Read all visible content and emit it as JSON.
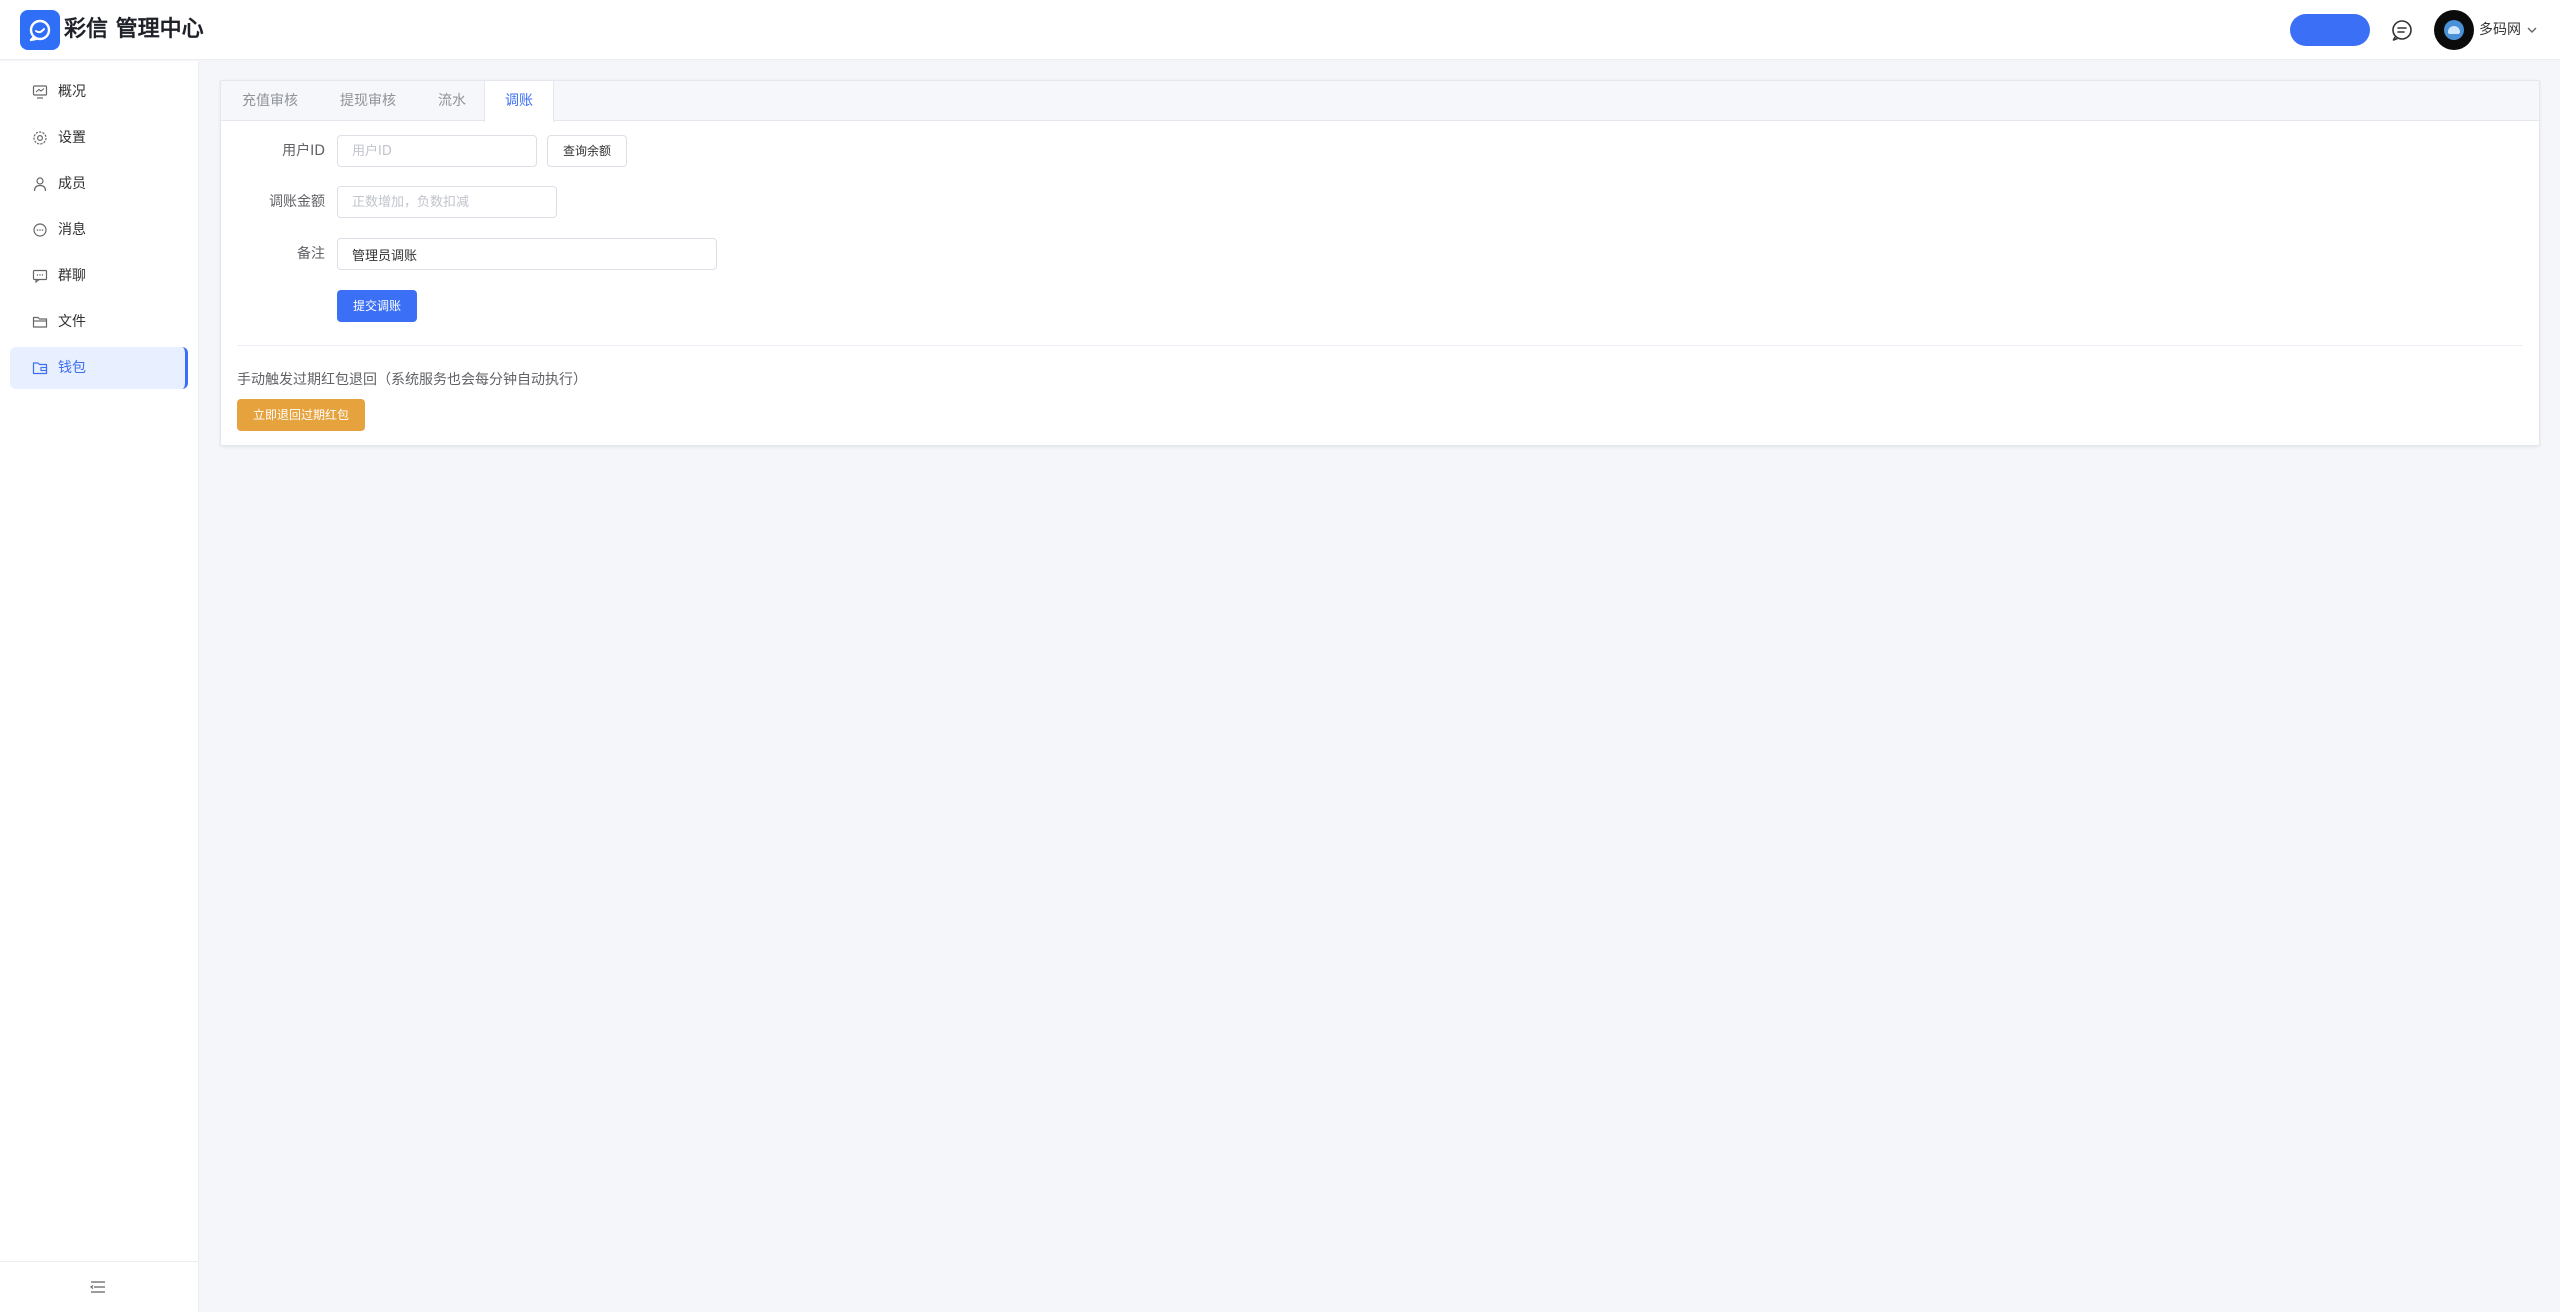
{
  "header": {
    "brand": "彩信 管理中心",
    "username": "多码网"
  },
  "sidebar": {
    "items": [
      {
        "label": "概况",
        "icon": "monitor-icon"
      },
      {
        "label": "设置",
        "icon": "gear-icon"
      },
      {
        "label": "成员",
        "icon": "user-icon"
      },
      {
        "label": "消息",
        "icon": "chat-bubble-icon"
      },
      {
        "label": "群聊",
        "icon": "group-chat-icon"
      },
      {
        "label": "文件",
        "icon": "folder-icon"
      },
      {
        "label": "钱包",
        "icon": "wallet-icon",
        "active": true
      }
    ]
  },
  "tabs": [
    {
      "label": "充值审核"
    },
    {
      "label": "提现审核"
    },
    {
      "label": "流水"
    },
    {
      "label": "调账",
      "active": true
    }
  ],
  "form": {
    "user_id_label": "用户ID",
    "user_id_placeholder": "用户ID",
    "query_balance_label": "查询余额",
    "amount_label": "调账金额",
    "amount_placeholder": "正数增加，负数扣减",
    "remark_label": "备注",
    "remark_value": "管理员调账",
    "submit_label": "提交调账"
  },
  "expired": {
    "note": "手动触发过期红包退回（系统服务也会每分钟自动执行）",
    "button_label": "立即退回过期红包"
  },
  "colors": {
    "primary": "#3b6ff5",
    "warning": "#e6a23c",
    "background": "#f5f6f9",
    "logo": "#2f6ef6"
  }
}
